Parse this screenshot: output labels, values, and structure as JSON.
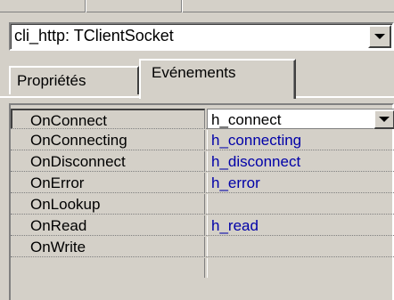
{
  "object_selector": {
    "value": "cli_http: TClientSocket",
    "dropdown_icon": "chevron-down-icon"
  },
  "tabs": [
    {
      "label": "Propriétés",
      "active": false
    },
    {
      "label": "Evénements",
      "active": true
    }
  ],
  "events": [
    {
      "name": "OnConnect",
      "handler": "h_connect",
      "selected": true
    },
    {
      "name": "OnConnecting",
      "handler": "h_connecting",
      "selected": false
    },
    {
      "name": "OnDisconnect",
      "handler": "h_disconnect",
      "selected": false
    },
    {
      "name": "OnError",
      "handler": "h_error",
      "selected": false
    },
    {
      "name": "OnLookup",
      "handler": "",
      "selected": false
    },
    {
      "name": "OnRead",
      "handler": "h_read",
      "selected": false
    },
    {
      "name": "OnWrite",
      "handler": "",
      "selected": false
    }
  ],
  "colors": {
    "face": "#d4d0c8",
    "handler_text": "#0000a8",
    "field_bg": "#ffffff"
  }
}
